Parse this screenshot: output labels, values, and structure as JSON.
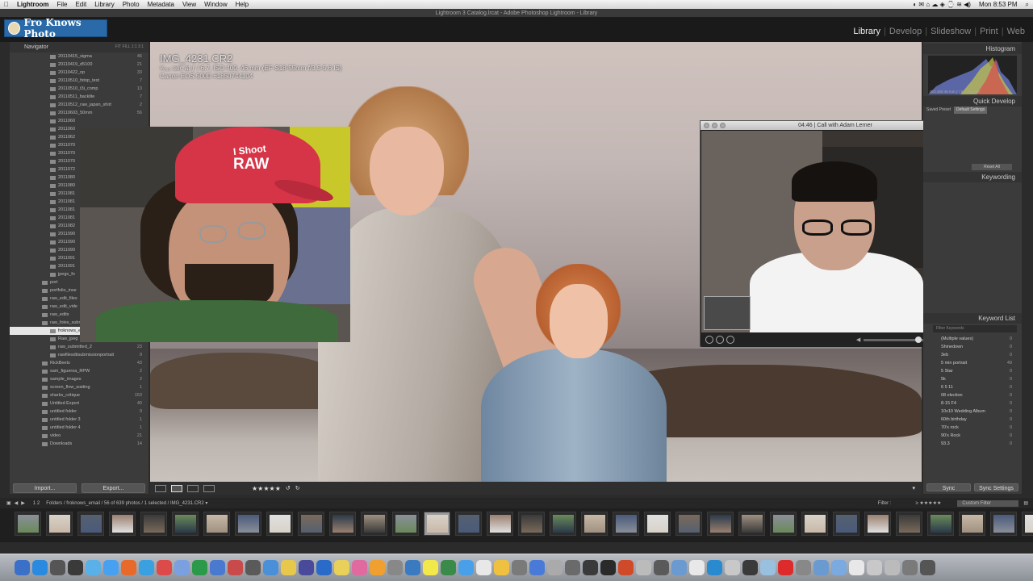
{
  "menubar": {
    "apple": "",
    "app_name": "Lightroom",
    "items": [
      "File",
      "Edit",
      "Library",
      "Photo",
      "Metadata",
      "View",
      "Window",
      "Help"
    ],
    "clock": "Mon 8:53 PM"
  },
  "window_title": "Lightroom 3 Catalog.lrcat - Adobe Photoshop Lightroom - Library",
  "identity_plate": "Fro Knows Photo",
  "modules": [
    "Library",
    "Develop",
    "Slideshow",
    "Print",
    "Web"
  ],
  "active_module": "Library",
  "left_panel": {
    "title": "Navigator",
    "nav_zoom": "FIT   FILL   1:1   3:1",
    "folders": [
      {
        "name": "20110415_sigma",
        "count": "46"
      },
      {
        "name": "20110419_d5100",
        "count": "21"
      },
      {
        "name": "20110422_np",
        "count": "33"
      },
      {
        "name": "20110510_fstop_test",
        "count": "7"
      },
      {
        "name": "20110510_t3i_comp",
        "count": "13"
      },
      {
        "name": "20110511_backlite",
        "count": "7"
      },
      {
        "name": "20110512_raw_japan_shirt",
        "count": "2"
      },
      {
        "name": "20110603_50mm",
        "count": "56"
      },
      {
        "name": "2011060",
        "count": ""
      },
      {
        "name": "2011060",
        "count": ""
      },
      {
        "name": "2011062",
        "count": ""
      },
      {
        "name": "2011070",
        "count": ""
      },
      {
        "name": "2011070",
        "count": ""
      },
      {
        "name": "2011070",
        "count": ""
      },
      {
        "name": "2011072",
        "count": ""
      },
      {
        "name": "2011080",
        "count": ""
      },
      {
        "name": "2011080",
        "count": ""
      },
      {
        "name": "2011081",
        "count": ""
      },
      {
        "name": "2011081",
        "count": ""
      },
      {
        "name": "2011081",
        "count": ""
      },
      {
        "name": "2011081",
        "count": ""
      },
      {
        "name": "2011082",
        "count": ""
      },
      {
        "name": "2011090",
        "count": ""
      },
      {
        "name": "2011090",
        "count": ""
      },
      {
        "name": "2011090",
        "count": ""
      },
      {
        "name": "2011091",
        "count": ""
      },
      {
        "name": "2011091",
        "count": ""
      },
      {
        "name": "jpegs_fo",
        "count": ""
      },
      {
        "name": "port",
        "count": ""
      },
      {
        "name": "portfolio_inse",
        "count": ""
      },
      {
        "name": "raw_edit_files",
        "count": ""
      },
      {
        "name": "raw_edit_vide",
        "count": ""
      },
      {
        "name": "raw_edits",
        "count": ""
      },
      {
        "name": "raw_foles_submitted",
        "count": "723"
      },
      {
        "name": "froknows_email",
        "count": "639",
        "selected": true
      },
      {
        "name": "Raw_jpeg",
        "count": "5"
      },
      {
        "name": "raw_submitted_2",
        "count": "23"
      },
      {
        "name": "rawfilesditsubmissionportrait",
        "count": "9"
      },
      {
        "name": "RickBeets",
        "count": "43"
      },
      {
        "name": "sam_figueroa_RPW",
        "count": "2"
      },
      {
        "name": "sample_images",
        "count": "2"
      },
      {
        "name": "screen_flow_waiting",
        "count": "1"
      },
      {
        "name": "sharks_critique",
        "count": "153"
      },
      {
        "name": "Untitled Export",
        "count": "40"
      },
      {
        "name": "untitled folder",
        "count": "9"
      },
      {
        "name": "untitled folder 3",
        "count": "1"
      },
      {
        "name": "untitled folder 4",
        "count": "1"
      },
      {
        "name": "video",
        "count": "21"
      },
      {
        "name": "Downloads",
        "count": "14"
      }
    ],
    "import_label": "Import...",
    "export_label": "Export..."
  },
  "photo_info": {
    "filename": "IMG_4231.CR2",
    "exposure": "¹⁄₅₀₀ sec at ƒ / 6.7, ISO 400, 46 mm (EF-S18-55mm f/3.5-5.6 IS)",
    "camera": "Canon EOS 500D #1850744104"
  },
  "webcam_cap_text_1": "I Shoot",
  "webcam_cap_text_2": "RAW",
  "call_window": {
    "title": "04:46 | Call with Adam Lerner"
  },
  "right_panel": {
    "histogram_title": "Histogram",
    "histogram_info": "ISO 400    46 mm    ƒ / 6.7    ¹⁄₅₀₀ sec",
    "quick_develop_title": "Quick Develop",
    "saved_preset": "Saved Preset",
    "default_settings": "Default Settings",
    "reset_all": "Reset All",
    "keywording_title": "Keywording",
    "keyword_list_title": "Keyword List",
    "filter_keywords": "Filter Keywords",
    "keywords": [
      {
        "name": "(Multiple values)",
        "count": "0"
      },
      {
        "name": "Shinedown",
        "count": "0"
      },
      {
        "name": "3eb",
        "count": "0"
      },
      {
        "name": "5 min portrait",
        "count": "49"
      },
      {
        "name": "5 Star",
        "count": "0"
      },
      {
        "name": "5k",
        "count": "0"
      },
      {
        "name": "6 5 11",
        "count": "0"
      },
      {
        "name": "08 election",
        "count": "0"
      },
      {
        "name": "8-15 F4",
        "count": "0"
      },
      {
        "name": "10x10 Wedding Album",
        "count": "0"
      },
      {
        "name": "60th birthday",
        "count": "0"
      },
      {
        "name": "70's rock",
        "count": "0"
      },
      {
        "name": "90's Rock",
        "count": "0"
      },
      {
        "name": "93.3",
        "count": "0"
      }
    ],
    "sync_label": "Sync",
    "sync_settings_label": "Sync Settings"
  },
  "toolbar": {
    "stars": "★★★★★"
  },
  "filmstrip_bar": {
    "pages": "1  2",
    "path": "Folders / froknows_email / 56 of 639 photos / 1 selected / IMG_4231.CR2 ▾",
    "filter_label": "Filter :",
    "filter_stars": "≥ ★★★★★",
    "custom_filter": "Custom Filter"
  },
  "filmstrip_count": 33,
  "colors": {
    "identity_plate_bg": "#2a6aa8",
    "cap_red": "#d63447",
    "panel_bg": "#3b3b3b"
  }
}
